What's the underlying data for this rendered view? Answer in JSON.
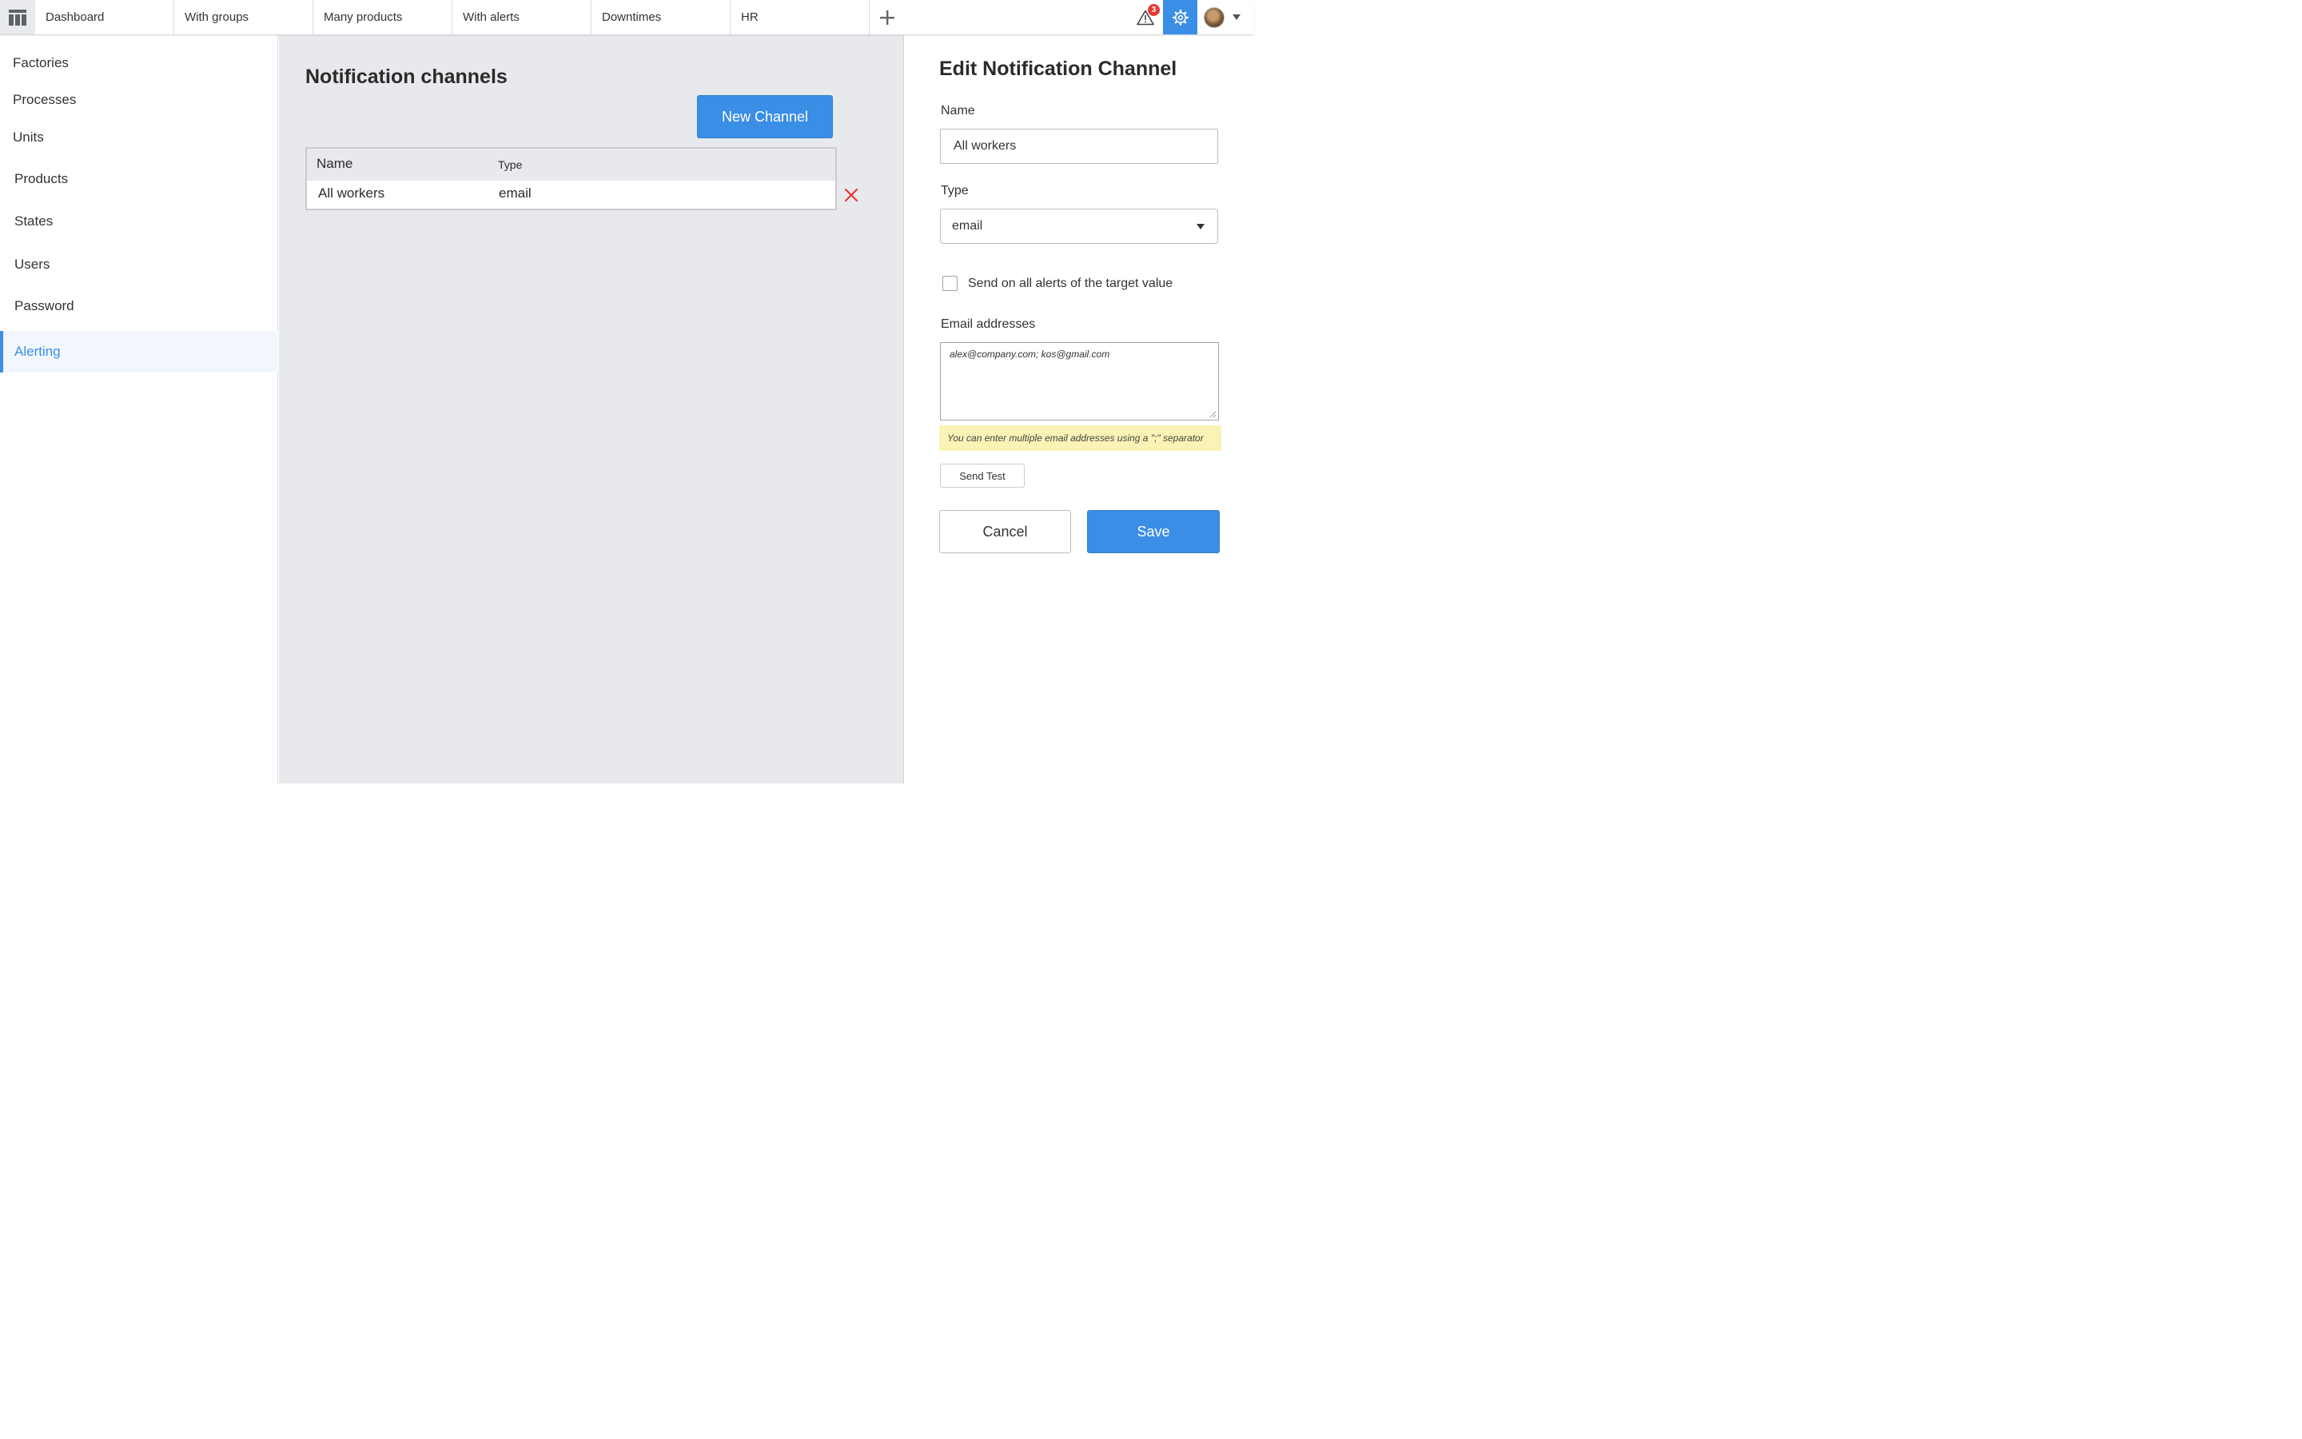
{
  "topbar": {
    "tabs": [
      "Dashboard",
      "With groups",
      "Many products",
      "With alerts",
      "Downtimes",
      "HR"
    ],
    "alert_count": "3",
    "accent_color": "#3a8ee6"
  },
  "sidebar": {
    "items": [
      {
        "label": "Factories"
      },
      {
        "label": "Processes"
      },
      {
        "label": "Units"
      },
      {
        "label": "Products"
      },
      {
        "label": "States"
      },
      {
        "label": "Users"
      },
      {
        "label": "Password"
      },
      {
        "label": "Alerting",
        "active": true
      }
    ]
  },
  "main": {
    "title": "Notification channels",
    "new_channel_label": "New Channel",
    "table": {
      "columns": [
        "Name",
        "Type"
      ],
      "rows": [
        {
          "name": "All workers",
          "type": "email"
        }
      ]
    }
  },
  "panel": {
    "title": "Edit Notification Channel",
    "name_label": "Name",
    "name_value": "All workers",
    "type_label": "Type",
    "type_value": "email",
    "checkbox_label": "Send on all alerts of the target value",
    "checkbox_checked": false,
    "email_label": "Email addresses",
    "email_value": "alex@company.com; kos@gmail.com",
    "hint": "You can enter multiple email addresses using a \";\" separator",
    "send_test_label": "Send Test",
    "cancel_label": "Cancel",
    "save_label": "Save"
  }
}
